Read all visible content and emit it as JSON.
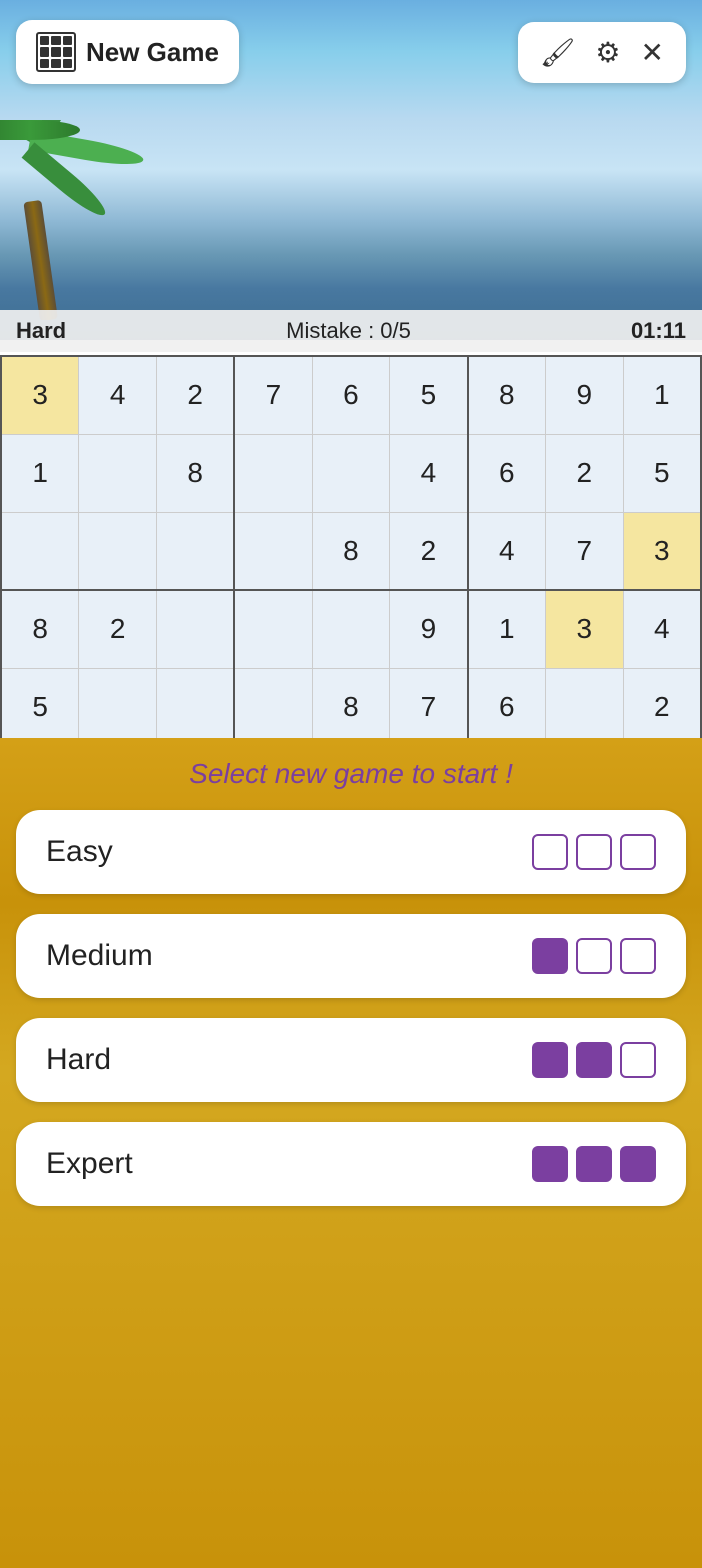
{
  "header": {
    "new_game_label": "New Game",
    "paint_icon": "🖌",
    "settings_icon": "⚙",
    "close_icon": "✕"
  },
  "status": {
    "difficulty": "Hard",
    "mistakes_label": "Mistake : 0/5",
    "timer": "01:11"
  },
  "grid": {
    "rows": [
      [
        {
          "val": "3",
          "bg": "selected"
        },
        {
          "val": "4",
          "bg": "normal"
        },
        {
          "val": "2",
          "bg": "normal"
        },
        {
          "val": "7",
          "bg": "normal"
        },
        {
          "val": "6",
          "bg": "normal"
        },
        {
          "val": "5",
          "bg": "normal"
        },
        {
          "val": "8",
          "bg": "normal"
        },
        {
          "val": "9",
          "bg": "normal"
        },
        {
          "val": "1",
          "bg": "normal"
        }
      ],
      [
        {
          "val": "1",
          "bg": "normal"
        },
        {
          "val": "",
          "bg": "normal"
        },
        {
          "val": "8",
          "bg": "normal"
        },
        {
          "val": "",
          "bg": "normal"
        },
        {
          "val": "",
          "bg": "normal"
        },
        {
          "val": "4",
          "bg": "normal"
        },
        {
          "val": "6",
          "bg": "normal"
        },
        {
          "val": "2",
          "bg": "normal"
        },
        {
          "val": "5",
          "bg": "normal"
        }
      ],
      [
        {
          "val": "",
          "bg": "normal"
        },
        {
          "val": "",
          "bg": "normal"
        },
        {
          "val": "",
          "bg": "normal"
        },
        {
          "val": "",
          "bg": "normal"
        },
        {
          "val": "8",
          "bg": "normal"
        },
        {
          "val": "2",
          "bg": "normal"
        },
        {
          "val": "4",
          "bg": "normal"
        },
        {
          "val": "7",
          "bg": "normal"
        },
        {
          "val": "3",
          "bg": "selected"
        }
      ],
      [
        {
          "val": "8",
          "bg": "normal"
        },
        {
          "val": "2",
          "bg": "normal"
        },
        {
          "val": "",
          "bg": "normal"
        },
        {
          "val": "",
          "bg": "normal"
        },
        {
          "val": "",
          "bg": "normal"
        },
        {
          "val": "9",
          "bg": "normal"
        },
        {
          "val": "1",
          "bg": "normal"
        },
        {
          "val": "3",
          "bg": "selected"
        },
        {
          "val": "4",
          "bg": "normal"
        }
      ],
      [
        {
          "val": "5",
          "bg": "normal"
        },
        {
          "val": "",
          "bg": "normal"
        },
        {
          "val": "",
          "bg": "normal"
        },
        {
          "val": "",
          "bg": "normal"
        },
        {
          "val": "8",
          "bg": "normal"
        },
        {
          "val": "7",
          "bg": "normal"
        },
        {
          "val": "6",
          "bg": "normal"
        },
        {
          "val": "",
          "bg": "normal"
        },
        {
          "val": "2",
          "bg": "normal"
        }
      ]
    ]
  },
  "overlay": {
    "title": "Select new game to start !",
    "difficulties": [
      {
        "label": "Easy",
        "filled": 0,
        "empty": 3
      },
      {
        "label": "Medium",
        "filled": 1,
        "empty": 2
      },
      {
        "label": "Hard",
        "filled": 2,
        "empty": 1
      },
      {
        "label": "Expert",
        "filled": 3,
        "empty": 0
      }
    ]
  }
}
